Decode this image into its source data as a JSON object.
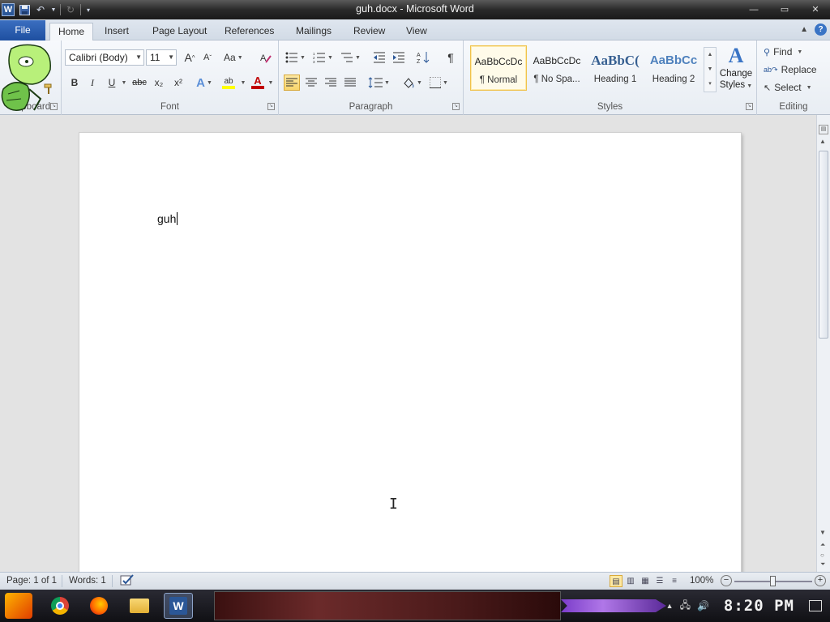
{
  "app": {
    "title": "guh.docx - Microsoft Word",
    "logo": "W"
  },
  "tabs": {
    "file": "File",
    "items": [
      "Home",
      "Insert",
      "Page Layout",
      "References",
      "Mailings",
      "Review",
      "View"
    ],
    "active": "Home",
    "help": "?"
  },
  "ribbon": {
    "clipboard": {
      "label": "Clipboard"
    },
    "font": {
      "label": "Font",
      "family": "Calibri (Body)",
      "size": "11",
      "grow": "A",
      "shrink": "A",
      "case": "Aa",
      "bold": "B",
      "italic": "I",
      "underline": "U",
      "strike": "abc",
      "subscript": "x₂",
      "superscript": "x²",
      "effects": "A",
      "highlight": "ab",
      "color": "A",
      "color_value": "#c00000",
      "highlight_value": "#ffff00"
    },
    "paragraph": {
      "label": "Paragraph",
      "pilcrow": "¶"
    },
    "styles": {
      "label": "Styles",
      "items": [
        {
          "sample": "AaBbCcDc",
          "name": "¶ Normal",
          "selected": true
        },
        {
          "sample": "AaBbCcDc",
          "name": "¶ No Spa...",
          "selected": false
        },
        {
          "sample": "AaBbC(",
          "name": "Heading 1",
          "selected": false
        },
        {
          "sample": "AaBbCc",
          "name": "Heading 2",
          "selected": false
        }
      ],
      "change_styles_line1": "Change",
      "change_styles_line2": "Styles"
    },
    "editing": {
      "label": "Editing",
      "find": "Find",
      "replace": "Replace",
      "select": "Select"
    }
  },
  "document": {
    "text": "guh"
  },
  "statusbar": {
    "page": "Page: 1 of 1",
    "words": "Words: 1",
    "zoom": "100%",
    "zoom_minus": "−",
    "zoom_plus": "+"
  },
  "taskbar": {
    "clock": "8:20 PM",
    "apps": [
      "chrome",
      "firefox",
      "file-explorer",
      "word"
    ],
    "active_app": "word"
  }
}
